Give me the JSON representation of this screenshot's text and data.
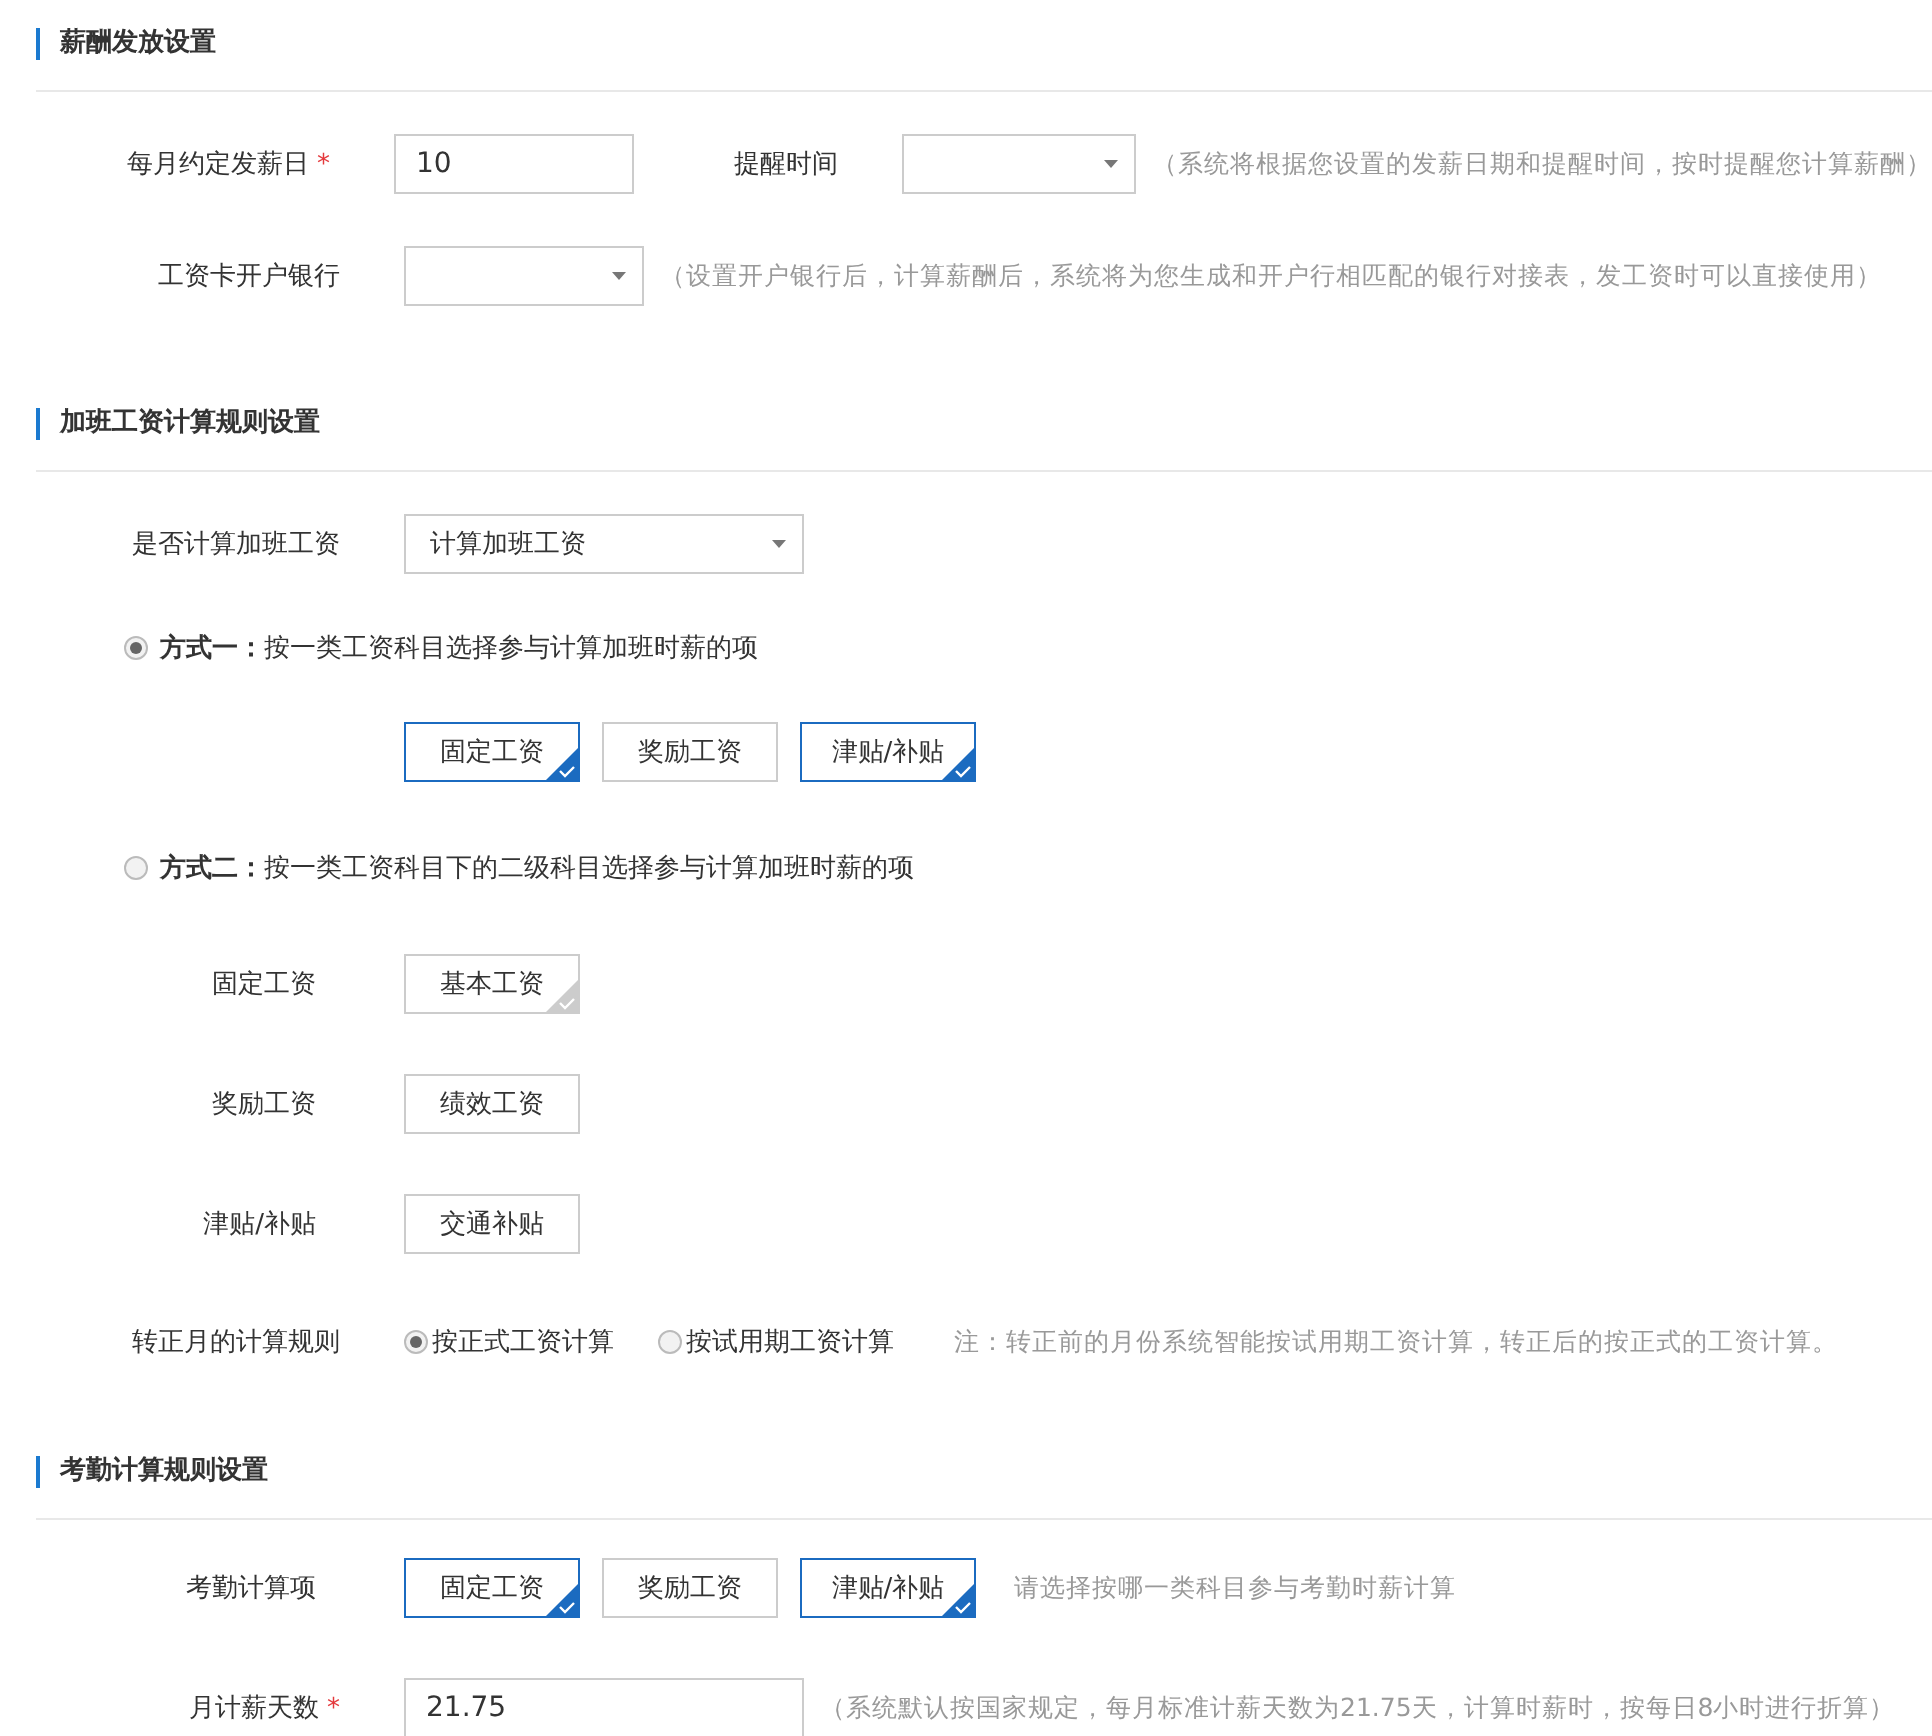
{
  "payroll": {
    "title": "薪酬发放设置",
    "payday": {
      "label": "每月约定发薪日",
      "required_mark": "*",
      "value": "10"
    },
    "remind": {
      "label": "提醒时间"
    },
    "remind_hint": "（系统将根据您设置的发薪日期和提醒时间，按时提醒您计算薪酬）",
    "bank": {
      "label": "工资卡开户银行"
    },
    "bank_hint": "（设置开户银行后，计算薪酬后，系统将为您生成和开户行相匹配的银行对接表，发工资时可以直接使用）"
  },
  "overtime": {
    "title": "加班工资计算规则设置",
    "calc": {
      "label": "是否计算加班工资",
      "value": "计算加班工资"
    },
    "method_one": {
      "selected": true,
      "label": "**方式一：**按一类工资科目选择参与计算加班时薪的项",
      "tags": [
        {
          "label": "固定工资",
          "checked": true
        },
        {
          "label": "奖励工资",
          "checked": false
        },
        {
          "label": "津贴/补贴",
          "checked": true
        }
      ]
    },
    "method_two": {
      "selected": false,
      "label": "**方式二：**按一类工资科目下的二级科目选择参与计算加班时薪的项",
      "groups": [
        {
          "label": "固定工资",
          "tags": [
            {
              "label": "基本工资",
              "checked": true
            }
          ]
        },
        {
          "label": "奖励工资",
          "tags": [
            {
              "label": "绩效工资",
              "checked": false
            }
          ]
        },
        {
          "label": "津贴/补贴",
          "tags": [
            {
              "label": "交通补贴",
              "checked": false
            }
          ]
        }
      ]
    },
    "probation": {
      "label": "转正月的计算规则",
      "options": [
        {
          "label": "按正式工资计算",
          "selected": true
        },
        {
          "label": "按试用期工资计算",
          "selected": false
        }
      ],
      "note": "注：转正前的月份系统智能按试用期工资计算，转正后的按正式的工资计算。"
    }
  },
  "attendance": {
    "title": "考勤计算规则设置",
    "items": {
      "label": "考勤计算项",
      "tags": [
        {
          "label": "固定工资",
          "checked": true
        },
        {
          "label": "奖励工资",
          "checked": false
        },
        {
          "label": "津贴/补贴",
          "checked": true
        }
      ],
      "hint": "请选择按哪一类科目参与考勤时薪计算"
    },
    "days": {
      "label": "月计薪天数",
      "required_mark": "*",
      "value": "21.75",
      "hint": "（系统默认按国家规定，每月标准计薪天数为21.75天，计算时薪时，按每日8小时进行折算）"
    }
  }
}
